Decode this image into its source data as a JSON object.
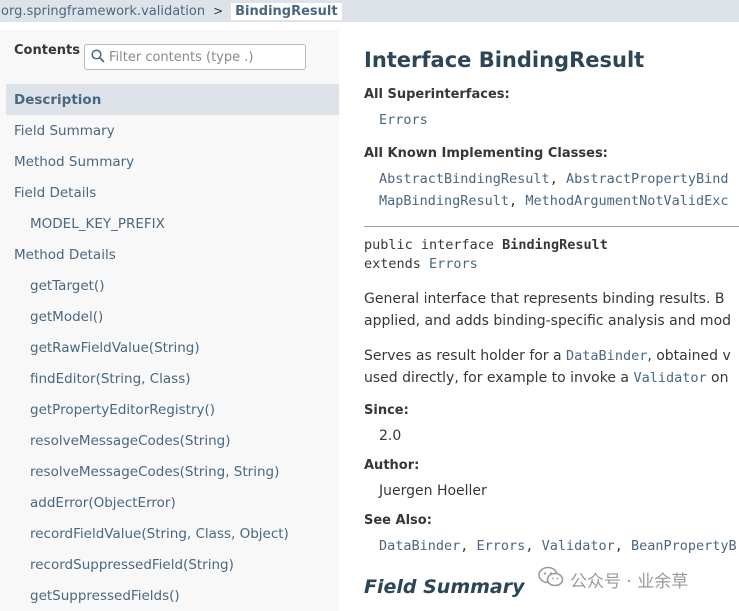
{
  "breadcrumb": {
    "package": "org.springframework.validation",
    "separator": ">",
    "current": "BindingResult"
  },
  "sidebar": {
    "title": "Contents",
    "filter_placeholder": "Filter contents (type .)",
    "items": [
      {
        "label": "Description",
        "level": 1,
        "selected": true
      },
      {
        "label": "Field Summary",
        "level": 1
      },
      {
        "label": "Method Summary",
        "level": 1
      },
      {
        "label": "Field Details",
        "level": 1
      },
      {
        "label": "MODEL_KEY_PREFIX",
        "level": 2
      },
      {
        "label": "Method Details",
        "level": 1
      },
      {
        "label": "getTarget()",
        "level": 2
      },
      {
        "label": "getModel()",
        "level": 2
      },
      {
        "label": "getRawFieldValue(String)",
        "level": 2
      },
      {
        "label": "findEditor(String, Class)",
        "level": 2
      },
      {
        "label": "getPropertyEditorRegistry()",
        "level": 2
      },
      {
        "label": "resolveMessageCodes(String)",
        "level": 2
      },
      {
        "label": "resolveMessageCodes(String, String)",
        "level": 2
      },
      {
        "label": "addError(ObjectError)",
        "level": 2
      },
      {
        "label": "recordFieldValue(String, Class, Object)",
        "level": 2
      },
      {
        "label": "recordSuppressedField(String)",
        "level": 2
      },
      {
        "label": "getSuppressedFields()",
        "level": 2
      }
    ]
  },
  "main": {
    "title": "Interface BindingResult",
    "superinterfaces_label": "All Superinterfaces:",
    "superinterfaces": [
      "Errors"
    ],
    "implementing_label": "All Known Implementing Classes:",
    "implementing_row1": [
      "AbstractBindingResult",
      "AbstractPropertyBind"
    ],
    "implementing_row2": [
      "MapBindingResult",
      "MethodArgumentNotValidExc"
    ],
    "sig_line1_prefix": "public interface ",
    "sig_line1_name": "BindingResult",
    "sig_line2_prefix": "extends ",
    "sig_line2_link": "Errors",
    "desc1_line1": "General interface that represents binding results. B",
    "desc1_line2": "applied, and adds binding-specific analysis and mod",
    "desc2_line1_prefix": "Serves as result holder for a ",
    "desc2_line1_link": "DataBinder",
    "desc2_line1_suffix": ", obtained v",
    "desc2_line2_prefix": "used directly, for example to invoke a ",
    "desc2_line2_link": "Validator",
    "desc2_line2_suffix": " on",
    "since_label": "Since:",
    "since_value": "2.0",
    "author_label": "Author:",
    "author_value": "Juergen Hoeller",
    "see_also_label": "See Also:",
    "see_also": [
      "DataBinder",
      "Errors",
      "Validator",
      "BeanPropertyB"
    ],
    "field_summary_title": "Field Summary"
  },
  "watermark": {
    "text": "公众号 · 业余草"
  },
  "colors": {
    "link": "#4a6782",
    "header_bg": "#dee3e9",
    "sidebar_bg": "#f8f8f8",
    "title": "#2c4557"
  }
}
